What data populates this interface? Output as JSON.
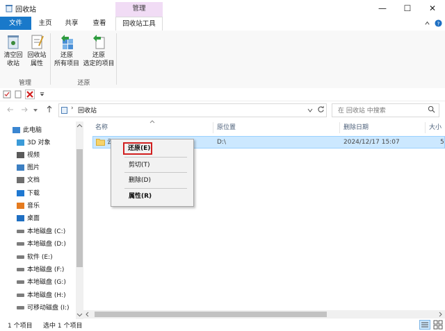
{
  "window": {
    "title": "回收站",
    "minimize_glyph": "—",
    "maximize_glyph": "☐",
    "close_glyph": "✕"
  },
  "ribbon_tabs": {
    "file": "文件",
    "home": "主页",
    "share": "共享",
    "view": "查看",
    "context_header": "管理",
    "recycle_tools": "回收站工具"
  },
  "ribbon": {
    "empty_bin": "清空回\n收站",
    "properties": "回收站\n属性",
    "restore_all": "还原\n所有项目",
    "restore_selected": "还原\n选定的项目",
    "group_manage": "管理",
    "group_restore": "还原"
  },
  "address": {
    "path": "回收站",
    "search_placeholder": "在 回收站 中搜索"
  },
  "nav": {
    "items": [
      {
        "label": "此电脑",
        "icon": "pc-icon"
      },
      {
        "label": "3D 对象",
        "icon": "3d-objects-icon"
      },
      {
        "label": "视频",
        "icon": "video-icon"
      },
      {
        "label": "图片",
        "icon": "picture-icon"
      },
      {
        "label": "文档",
        "icon": "document-icon"
      },
      {
        "label": "下载",
        "icon": "download-icon"
      },
      {
        "label": "音乐",
        "icon": "music-icon"
      },
      {
        "label": "桌面",
        "icon": "desktop-icon"
      },
      {
        "label": "本地磁盘 (C:)",
        "icon": "drive-icon"
      },
      {
        "label": "本地磁盘 (D:)",
        "icon": "drive-icon"
      },
      {
        "label": "软件 (E:)",
        "icon": "drive-icon"
      },
      {
        "label": "本地磁盘 (F:)",
        "icon": "drive-icon"
      },
      {
        "label": "本地磁盘 (G:)",
        "icon": "drive-icon"
      },
      {
        "label": "本地磁盘 (H:)",
        "icon": "drive-icon"
      },
      {
        "label": "可移动磁盘 (I:)",
        "icon": "removable-drive-icon"
      }
    ]
  },
  "columns": {
    "name": "名称",
    "original_location": "原位置",
    "date_deleted": "删除日期",
    "size": "大小"
  },
  "row": {
    "name": "云",
    "original_location": "D:\\",
    "date_deleted": "2024/12/17 15:07",
    "size": "5"
  },
  "context_menu": {
    "restore": "还原(E)",
    "cut": "剪切(T)",
    "delete": "删除(D)",
    "properties": "属性(R)"
  },
  "status": {
    "item_count": "1 个项目",
    "selected": "选中 1 个项目"
  },
  "colors": {
    "file_tab": "#1979ca",
    "manage_header": "#f1dcf5",
    "selection": "#cce8ff",
    "highlight_border": "#d11f1f"
  }
}
